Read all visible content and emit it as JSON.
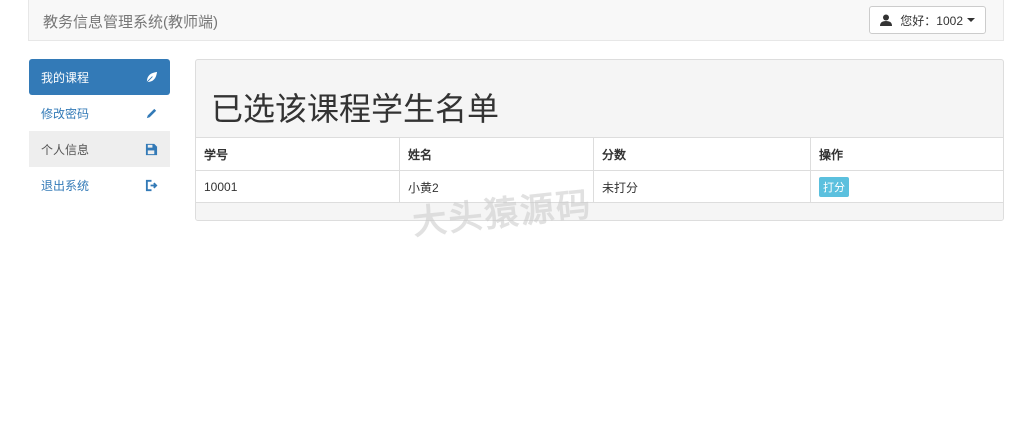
{
  "navbar": {
    "brand": "教务信息管理系统(教师端)",
    "user_label": "您好：1002"
  },
  "sidebar": {
    "items": [
      {
        "label": "我的课程",
        "icon": "leaf-icon"
      },
      {
        "label": "修改密码",
        "icon": "pencil-icon"
      },
      {
        "label": "个人信息",
        "icon": "floppy-icon"
      },
      {
        "label": "退出系统",
        "icon": "logout-icon"
      }
    ]
  },
  "main": {
    "title": "已选该课程学生名单",
    "table": {
      "headers": [
        "学号",
        "姓名",
        "分数",
        "操作"
      ],
      "rows": [
        {
          "id": "10001",
          "name": "小黄2",
          "score": "未打分",
          "action": "打分"
        }
      ]
    }
  },
  "watermark": "大头猿源码",
  "colors": {
    "primary": "#337ab7",
    "info": "#5bc0de"
  }
}
